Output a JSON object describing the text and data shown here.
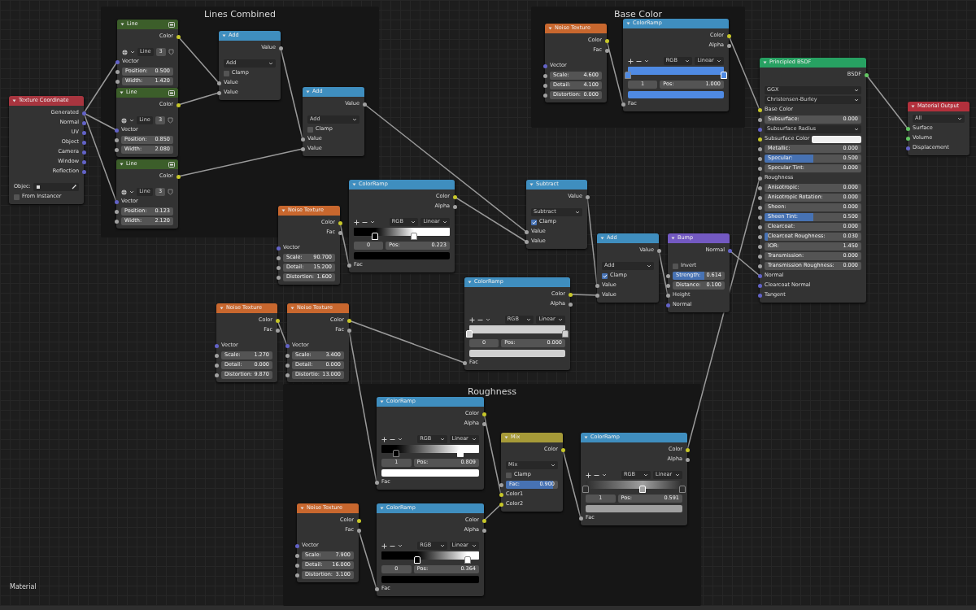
{
  "frames": [
    {
      "label": "Lines Combined"
    },
    {
      "label": "Base Color"
    },
    {
      "label": "Roughness"
    }
  ],
  "nodes": [
    {
      "title": "Texture Coordinate",
      "kind": "input",
      "rows": [
        {
          "kind": "output",
          "label": "Generated",
          "socket": {
            "kind": "vector"
          }
        },
        {
          "kind": "output",
          "label": "Normal",
          "socket": {
            "kind": "vector"
          }
        },
        {
          "kind": "output",
          "label": "UV",
          "socket": {
            "kind": "vector"
          }
        },
        {
          "kind": "output",
          "label": "Object",
          "socket": {
            "kind": "vector"
          }
        },
        {
          "kind": "output",
          "label": "Camera",
          "socket": {
            "kind": "vector"
          }
        },
        {
          "kind": "output",
          "label": "Window",
          "socket": {
            "kind": "vector"
          }
        },
        {
          "kind": "output",
          "label": "Reflection",
          "socket": {
            "kind": "vector"
          }
        },
        {
          "kind": "object",
          "label": "Objec:"
        },
        {
          "kind": "checkbox",
          "label": "From Instancer",
          "checked": false
        }
      ]
    },
    {
      "title": "Line",
      "kind": "group",
      "rows": [
        {
          "kind": "output",
          "label": "Color",
          "socket": {
            "kind": "color"
          }
        },
        {
          "kind": "group_tools",
          "name": "Line",
          "users": "3"
        },
        {
          "kind": "input",
          "label": "Vector",
          "socket": {
            "kind": "vector"
          }
        },
        {
          "kind": "number",
          "label": "Position:",
          "value": "0.500",
          "socket": {
            "kind": "value"
          }
        },
        {
          "kind": "number",
          "label": "Width:",
          "value": "1.420",
          "socket": {
            "kind": "value"
          }
        }
      ]
    },
    {
      "title": "Line",
      "kind": "group",
      "rows": [
        {
          "kind": "output",
          "label": "Color",
          "socket": {
            "kind": "color"
          }
        },
        {
          "kind": "group_tools",
          "name": "Line",
          "users": "3"
        },
        {
          "kind": "input",
          "label": "Vector",
          "socket": {
            "kind": "vector"
          }
        },
        {
          "kind": "number",
          "label": "Position:",
          "value": "0.850",
          "socket": {
            "kind": "value"
          }
        },
        {
          "kind": "number",
          "label": "Width:",
          "value": "2.080",
          "socket": {
            "kind": "value"
          }
        }
      ]
    },
    {
      "title": "Line",
      "kind": "group",
      "rows": [
        {
          "kind": "output",
          "label": "Color",
          "socket": {
            "kind": "color"
          }
        },
        {
          "kind": "group_tools",
          "name": "Line",
          "users": "3"
        },
        {
          "kind": "input",
          "label": "Vector",
          "socket": {
            "kind": "vector"
          }
        },
        {
          "kind": "number",
          "label": "Position:",
          "value": "0.123",
          "socket": {
            "kind": "value"
          }
        },
        {
          "kind": "number",
          "label": "Width:",
          "value": "2.120",
          "socket": {
            "kind": "value"
          }
        }
      ]
    },
    {
      "title": "Add",
      "kind": "converter",
      "rows": [
        {
          "kind": "output",
          "label": "Value",
          "socket": {
            "kind": "value"
          }
        },
        {
          "kind": "dropdown",
          "value": "Add"
        },
        {
          "kind": "checkbox",
          "label": "Clamp",
          "checked": false
        },
        {
          "kind": "input",
          "label": "Value",
          "socket": {
            "kind": "value"
          }
        },
        {
          "kind": "input",
          "label": "Value",
          "socket": {
            "kind": "value"
          }
        }
      ]
    },
    {
      "title": "Add",
      "kind": "converter",
      "rows": [
        {
          "kind": "output",
          "label": "Value",
          "socket": {
            "kind": "value"
          }
        },
        {
          "kind": "dropdown",
          "value": "Add"
        },
        {
          "kind": "checkbox",
          "label": "Clamp",
          "checked": false
        },
        {
          "kind": "input",
          "label": "Value",
          "socket": {
            "kind": "value"
          }
        },
        {
          "kind": "input",
          "label": "Value",
          "socket": {
            "kind": "value"
          }
        }
      ]
    },
    {
      "title": "Noise Texture",
      "kind": "texture",
      "rows": [
        {
          "kind": "output",
          "label": "Color",
          "socket": {
            "kind": "color"
          }
        },
        {
          "kind": "output",
          "label": "Fac",
          "socket": {
            "kind": "value"
          }
        },
        {
          "kind": "input",
          "label": "Vector",
          "socket": {
            "kind": "vector"
          }
        },
        {
          "kind": "number",
          "label": "Scale:",
          "value": "90.700",
          "socket": {
            "kind": "value"
          }
        },
        {
          "kind": "number",
          "label": "Detail:",
          "value": "15.200",
          "socket": {
            "kind": "value"
          }
        },
        {
          "kind": "number",
          "label": "Distortion:",
          "value": "1.600",
          "socket": {
            "kind": "value"
          }
        }
      ]
    },
    {
      "title": "ColorRamp",
      "kind": "converter",
      "rows": [
        {
          "kind": "output",
          "label": "Color",
          "socket": {
            "kind": "color"
          }
        },
        {
          "kind": "output",
          "label": "Alpha",
          "socket": {
            "kind": "value"
          }
        },
        {
          "kind": "ramp_tools",
          "mode": "RGB",
          "interpolation": "Linear"
        },
        {
          "kind": "ramp",
          "stops": [
            {
              "level": 0.223,
              "color": "#000000",
              "selected": true
            },
            {
              "level": 0.63,
              "color": "#ffffff",
              "selected": false
            }
          ]
        },
        {
          "kind": "ramp_pos",
          "index": "0",
          "label": "Pos:",
          "value": "0.223"
        },
        {
          "kind": "swatch",
          "color": "#000000"
        },
        {
          "kind": "input",
          "label": "Fac",
          "socket": {
            "kind": "value"
          }
        }
      ]
    },
    {
      "title": "Noise Texture",
      "kind": "texture",
      "rows": [
        {
          "kind": "output",
          "label": "Color",
          "socket": {
            "kind": "color"
          }
        },
        {
          "kind": "output",
          "label": "Fac",
          "socket": {
            "kind": "value"
          }
        },
        {
          "kind": "input",
          "label": "Vector",
          "socket": {
            "kind": "vector"
          }
        },
        {
          "kind": "number",
          "label": "Scale:",
          "value": "4.600",
          "socket": {
            "kind": "value"
          }
        },
        {
          "kind": "number",
          "label": "Detail:",
          "value": "4.100",
          "socket": {
            "kind": "value"
          }
        },
        {
          "kind": "number",
          "label": "Distortion:",
          "value": "0.000",
          "socket": {
            "kind": "value"
          }
        }
      ]
    },
    {
      "title": "ColorRamp",
      "kind": "converter",
      "rows": [
        {
          "kind": "output",
          "label": "Color",
          "socket": {
            "kind": "color"
          }
        },
        {
          "kind": "output",
          "label": "Alpha",
          "socket": {
            "kind": "value"
          }
        },
        {
          "kind": "ramp_tools",
          "mode": "RGB",
          "interpolation": "Linear"
        },
        {
          "kind": "ramp",
          "stops": [
            {
              "level": 0,
              "color": "#4f8ae3",
              "selected": false
            },
            {
              "level": 1,
              "color": "#4f8ae3",
              "selected": true
            }
          ]
        },
        {
          "kind": "ramp_pos",
          "index": "1",
          "label": "Pos:",
          "value": "1.000"
        },
        {
          "kind": "swatch",
          "color": "#4f8ae3"
        },
        {
          "kind": "input",
          "label": "Fac",
          "socket": {
            "kind": "value"
          }
        }
      ]
    },
    {
      "title": "Principled BSDF",
      "kind": "shader",
      "rows": [
        {
          "kind": "output",
          "label": "BSDF",
          "socket": {
            "kind": "shader"
          }
        },
        {
          "kind": "dropdown",
          "value": "GGX"
        },
        {
          "kind": "dropdown",
          "value": "Christensen-Burley"
        },
        {
          "kind": "input",
          "label": "Base Color",
          "socket": {
            "kind": "color"
          }
        },
        {
          "kind": "slider",
          "label": "Subsurface:",
          "value": "0.000",
          "level": 0,
          "socket": {
            "kind": "value"
          }
        },
        {
          "kind": "dropdown",
          "value": "Subsurface Radius",
          "socket": {
            "kind": "vector"
          }
        },
        {
          "kind": "color_input",
          "label": "Subsurface Color",
          "color": "#f0f0f0",
          "socket": {
            "kind": "color"
          }
        },
        {
          "kind": "slider",
          "label": "Metallic:",
          "value": "0.000",
          "level": 0,
          "socket": {
            "kind": "value"
          }
        },
        {
          "kind": "slider",
          "label": "Specular:",
          "value": "0.500",
          "level": 0.5,
          "socket": {
            "kind": "value"
          }
        },
        {
          "kind": "slider",
          "label": "Specular Tint:",
          "value": "0.000",
          "level": 0,
          "socket": {
            "kind": "value"
          }
        },
        {
          "kind": "input",
          "label": "Roughness",
          "socket": {
            "kind": "value"
          }
        },
        {
          "kind": "slider",
          "label": "Anisotropic:",
          "value": "0.000",
          "level": 0,
          "socket": {
            "kind": "value"
          }
        },
        {
          "kind": "slider",
          "label": "Anisotropic Rotation:",
          "value": "0.000",
          "level": 0,
          "socket": {
            "kind": "value"
          }
        },
        {
          "kind": "slider",
          "label": "Sheen:",
          "value": "0.000",
          "level": 0,
          "socket": {
            "kind": "value"
          }
        },
        {
          "kind": "slider",
          "label": "Sheen Tint:",
          "value": "0.500",
          "level": 0.5,
          "socket": {
            "kind": "value"
          }
        },
        {
          "kind": "slider",
          "label": "Clearcoat:",
          "value": "0.000",
          "level": 0,
          "socket": {
            "kind": "value"
          }
        },
        {
          "kind": "slider",
          "label": "Clearcoat Roughness:",
          "value": "0.030",
          "level": 0.03,
          "socket": {
            "kind": "value"
          }
        },
        {
          "kind": "number",
          "label": "IOR:",
          "value": "1.450",
          "socket": {
            "kind": "value"
          }
        },
        {
          "kind": "slider",
          "label": "Transmission:",
          "value": "0.000",
          "level": 0,
          "socket": {
            "kind": "value"
          }
        },
        {
          "kind": "slider",
          "label": "Transmission Roughness:",
          "value": "0.000",
          "level": 0,
          "socket": {
            "kind": "value"
          }
        },
        {
          "kind": "input",
          "label": "Normal",
          "socket": {
            "kind": "vector"
          }
        },
        {
          "kind": "input",
          "label": "Clearcoat Normal",
          "socket": {
            "kind": "vector"
          }
        },
        {
          "kind": "input",
          "label": "Tangent",
          "socket": {
            "kind": "vector"
          }
        }
      ]
    },
    {
      "title": "Material Output",
      "kind": "output",
      "rows": [
        {
          "kind": "dropdown",
          "value": "All"
        },
        {
          "kind": "input",
          "label": "Surface",
          "socket": {
            "kind": "shader"
          }
        },
        {
          "kind": "input",
          "label": "Volume",
          "socket": {
            "kind": "shader"
          }
        },
        {
          "kind": "input",
          "label": "Displacement",
          "socket": {
            "kind": "vector"
          }
        }
      ]
    },
    {
      "title": "Subtract",
      "kind": "converter",
      "rows": [
        {
          "kind": "output",
          "label": "Value",
          "socket": {
            "kind": "value"
          }
        },
        {
          "kind": "dropdown",
          "value": "Subtract"
        },
        {
          "kind": "checkbox",
          "label": "Clamp",
          "checked": true
        },
        {
          "kind": "input",
          "label": "Value",
          "socket": {
            "kind": "value"
          }
        },
        {
          "kind": "input",
          "label": "Value",
          "socket": {
            "kind": "value"
          }
        }
      ]
    },
    {
      "title": "Add",
      "kind": "converter",
      "rows": [
        {
          "kind": "output",
          "label": "Value",
          "socket": {
            "kind": "value"
          }
        },
        {
          "kind": "dropdown",
          "value": "Add"
        },
        {
          "kind": "checkbox",
          "label": "Clamp",
          "checked": true
        },
        {
          "kind": "input",
          "label": "Value",
          "socket": {
            "kind": "value"
          }
        },
        {
          "kind": "input",
          "label": "Value",
          "socket": {
            "kind": "value"
          }
        }
      ]
    },
    {
      "title": "Bump",
      "kind": "vector",
      "rows": [
        {
          "kind": "output",
          "label": "Normal",
          "socket": {
            "kind": "vector"
          }
        },
        {
          "kind": "checkbox",
          "label": "Invert",
          "checked": false
        },
        {
          "kind": "slider",
          "label": "Strength:",
          "value": "0.614",
          "level": 0.614,
          "socket": {
            "kind": "value"
          }
        },
        {
          "kind": "number",
          "label": "Distance:",
          "value": "0.100",
          "socket": {
            "kind": "value"
          }
        },
        {
          "kind": "input",
          "label": "Height",
          "socket": {
            "kind": "value"
          }
        },
        {
          "kind": "input",
          "label": "Normal",
          "socket": {
            "kind": "vector"
          }
        }
      ]
    },
    {
      "title": "ColorRamp",
      "kind": "converter",
      "rows": [
        {
          "kind": "output",
          "label": "Color",
          "socket": {
            "kind": "color"
          }
        },
        {
          "kind": "output",
          "label": "Alpha",
          "socket": {
            "kind": "value"
          }
        },
        {
          "kind": "ramp_tools",
          "mode": "RGB",
          "interpolation": "Linear"
        },
        {
          "kind": "ramp",
          "stops": [
            {
              "level": 0,
              "color": "#d0d0d0",
              "selected": true
            },
            {
              "level": 1,
              "color": "#d0d0d0",
              "selected": false
            }
          ]
        },
        {
          "kind": "ramp_pos",
          "index": "0",
          "label": "Pos:",
          "value": "0.000"
        },
        {
          "kind": "swatch",
          "color": "#d0d0d0"
        },
        {
          "kind": "input",
          "label": "Fac",
          "socket": {
            "kind": "value"
          }
        }
      ]
    },
    {
      "title": "Noise Texture",
      "kind": "texture",
      "rows": [
        {
          "kind": "output",
          "label": "Color",
          "socket": {
            "kind": "color"
          }
        },
        {
          "kind": "output",
          "label": "Fac",
          "socket": {
            "kind": "value"
          }
        },
        {
          "kind": "input",
          "label": "Vector",
          "socket": {
            "kind": "vector"
          }
        },
        {
          "kind": "number",
          "label": "Scale:",
          "value": "1.270",
          "socket": {
            "kind": "value"
          }
        },
        {
          "kind": "number",
          "label": "Detail:",
          "value": "0.000",
          "socket": {
            "kind": "value"
          }
        },
        {
          "kind": "number",
          "label": "Distortion:",
          "value": "9.870",
          "socket": {
            "kind": "value"
          }
        }
      ]
    },
    {
      "title": "Noise Texture",
      "kind": "texture",
      "rows": [
        {
          "kind": "output",
          "label": "Color",
          "socket": {
            "kind": "color"
          }
        },
        {
          "kind": "output",
          "label": "Fac",
          "socket": {
            "kind": "value"
          }
        },
        {
          "kind": "input",
          "label": "Vector",
          "socket": {
            "kind": "vector"
          }
        },
        {
          "kind": "number",
          "label": "Scale:",
          "value": "3.400",
          "socket": {
            "kind": "value"
          }
        },
        {
          "kind": "number",
          "label": "Detail:",
          "value": "0.000",
          "socket": {
            "kind": "value"
          }
        },
        {
          "kind": "number",
          "label": "Distortio:",
          "value": "13.000",
          "socket": {
            "kind": "value"
          }
        }
      ]
    },
    {
      "title": "ColorRamp",
      "kind": "converter",
      "rows": [
        {
          "kind": "output",
          "label": "Color",
          "socket": {
            "kind": "color"
          }
        },
        {
          "kind": "output",
          "label": "Alpha",
          "socket": {
            "kind": "value"
          }
        },
        {
          "kind": "ramp_tools",
          "mode": "RGB",
          "interpolation": "Linear"
        },
        {
          "kind": "ramp",
          "stops": [
            {
              "level": 0.15,
              "color": "#000000",
              "selected": false
            },
            {
              "level": 0.809,
              "color": "#ffffff",
              "selected": true
            }
          ]
        },
        {
          "kind": "ramp_pos",
          "index": "1",
          "label": "Pos:",
          "value": "0.809"
        },
        {
          "kind": "swatch",
          "color": "#ffffff"
        },
        {
          "kind": "input",
          "label": "Fac",
          "socket": {
            "kind": "value"
          }
        }
      ]
    },
    {
      "title": "Mix",
      "kind": "color",
      "rows": [
        {
          "kind": "output",
          "label": "Color",
          "socket": {
            "kind": "color"
          }
        },
        {
          "kind": "dropdown",
          "value": "Mix"
        },
        {
          "kind": "checkbox",
          "label": "Clamp",
          "checked": false
        },
        {
          "kind": "slider",
          "label": "Fac:",
          "value": "0.900",
          "level": 0.9,
          "socket": {
            "kind": "value"
          }
        },
        {
          "kind": "input",
          "label": "Color1",
          "socket": {
            "kind": "color"
          }
        },
        {
          "kind": "input",
          "label": "Color2",
          "socket": {
            "kind": "color"
          }
        }
      ]
    },
    {
      "title": "ColorRamp",
      "kind": "converter",
      "rows": [
        {
          "kind": "output",
          "label": "Color",
          "socket": {
            "kind": "color"
          }
        },
        {
          "kind": "output",
          "label": "Alpha",
          "socket": {
            "kind": "value"
          }
        },
        {
          "kind": "ramp_tools",
          "mode": "RGB",
          "interpolation": "Linear"
        },
        {
          "kind": "ramp",
          "stops": [
            {
              "level": 0,
              "color": "#2e2e2e",
              "selected": false
            },
            {
              "level": 0.591,
              "color": "#a0a0a0",
              "selected": true
            },
            {
              "level": 1,
              "color": "#2e2e2e",
              "selected": false
            }
          ]
        },
        {
          "kind": "ramp_pos",
          "index": "1",
          "label": "Pos:",
          "value": "0.591"
        },
        {
          "kind": "swatch",
          "color": "#a0a0a0"
        },
        {
          "kind": "input",
          "label": "Fac",
          "socket": {
            "kind": "value"
          }
        }
      ]
    },
    {
      "title": "Noise Texture",
      "kind": "texture",
      "rows": [
        {
          "kind": "output",
          "label": "Color",
          "socket": {
            "kind": "color"
          }
        },
        {
          "kind": "output",
          "label": "Fac",
          "socket": {
            "kind": "value"
          }
        },
        {
          "kind": "input",
          "label": "Vector",
          "socket": {
            "kind": "vector"
          }
        },
        {
          "kind": "number",
          "label": "Scale:",
          "value": "7.900",
          "socket": {
            "kind": "value"
          }
        },
        {
          "kind": "number",
          "label": "Detail:",
          "value": "16.000",
          "socket": {
            "kind": "value"
          }
        },
        {
          "kind": "number",
          "label": "Distortion:",
          "value": "3.100",
          "socket": {
            "kind": "value"
          }
        }
      ]
    },
    {
      "title": "ColorRamp",
      "kind": "converter",
      "rows": [
        {
          "kind": "output",
          "label": "Color",
          "socket": {
            "kind": "color"
          }
        },
        {
          "kind": "output",
          "label": "Alpha",
          "socket": {
            "kind": "value"
          }
        },
        {
          "kind": "ramp_tools",
          "mode": "RGB",
          "interpolation": "Linear"
        },
        {
          "kind": "ramp",
          "stops": [
            {
              "level": 0.364,
              "color": "#000000",
              "selected": true
            },
            {
              "level": 0.88,
              "color": "#ffffff",
              "selected": false
            }
          ]
        },
        {
          "kind": "ramp_pos",
          "index": "0",
          "label": "Pos:",
          "value": "0.364"
        },
        {
          "kind": "swatch",
          "color": "#000000"
        },
        {
          "kind": "input",
          "label": "Fac",
          "socket": {
            "kind": "value"
          }
        }
      ]
    }
  ],
  "editor_label": "Material"
}
